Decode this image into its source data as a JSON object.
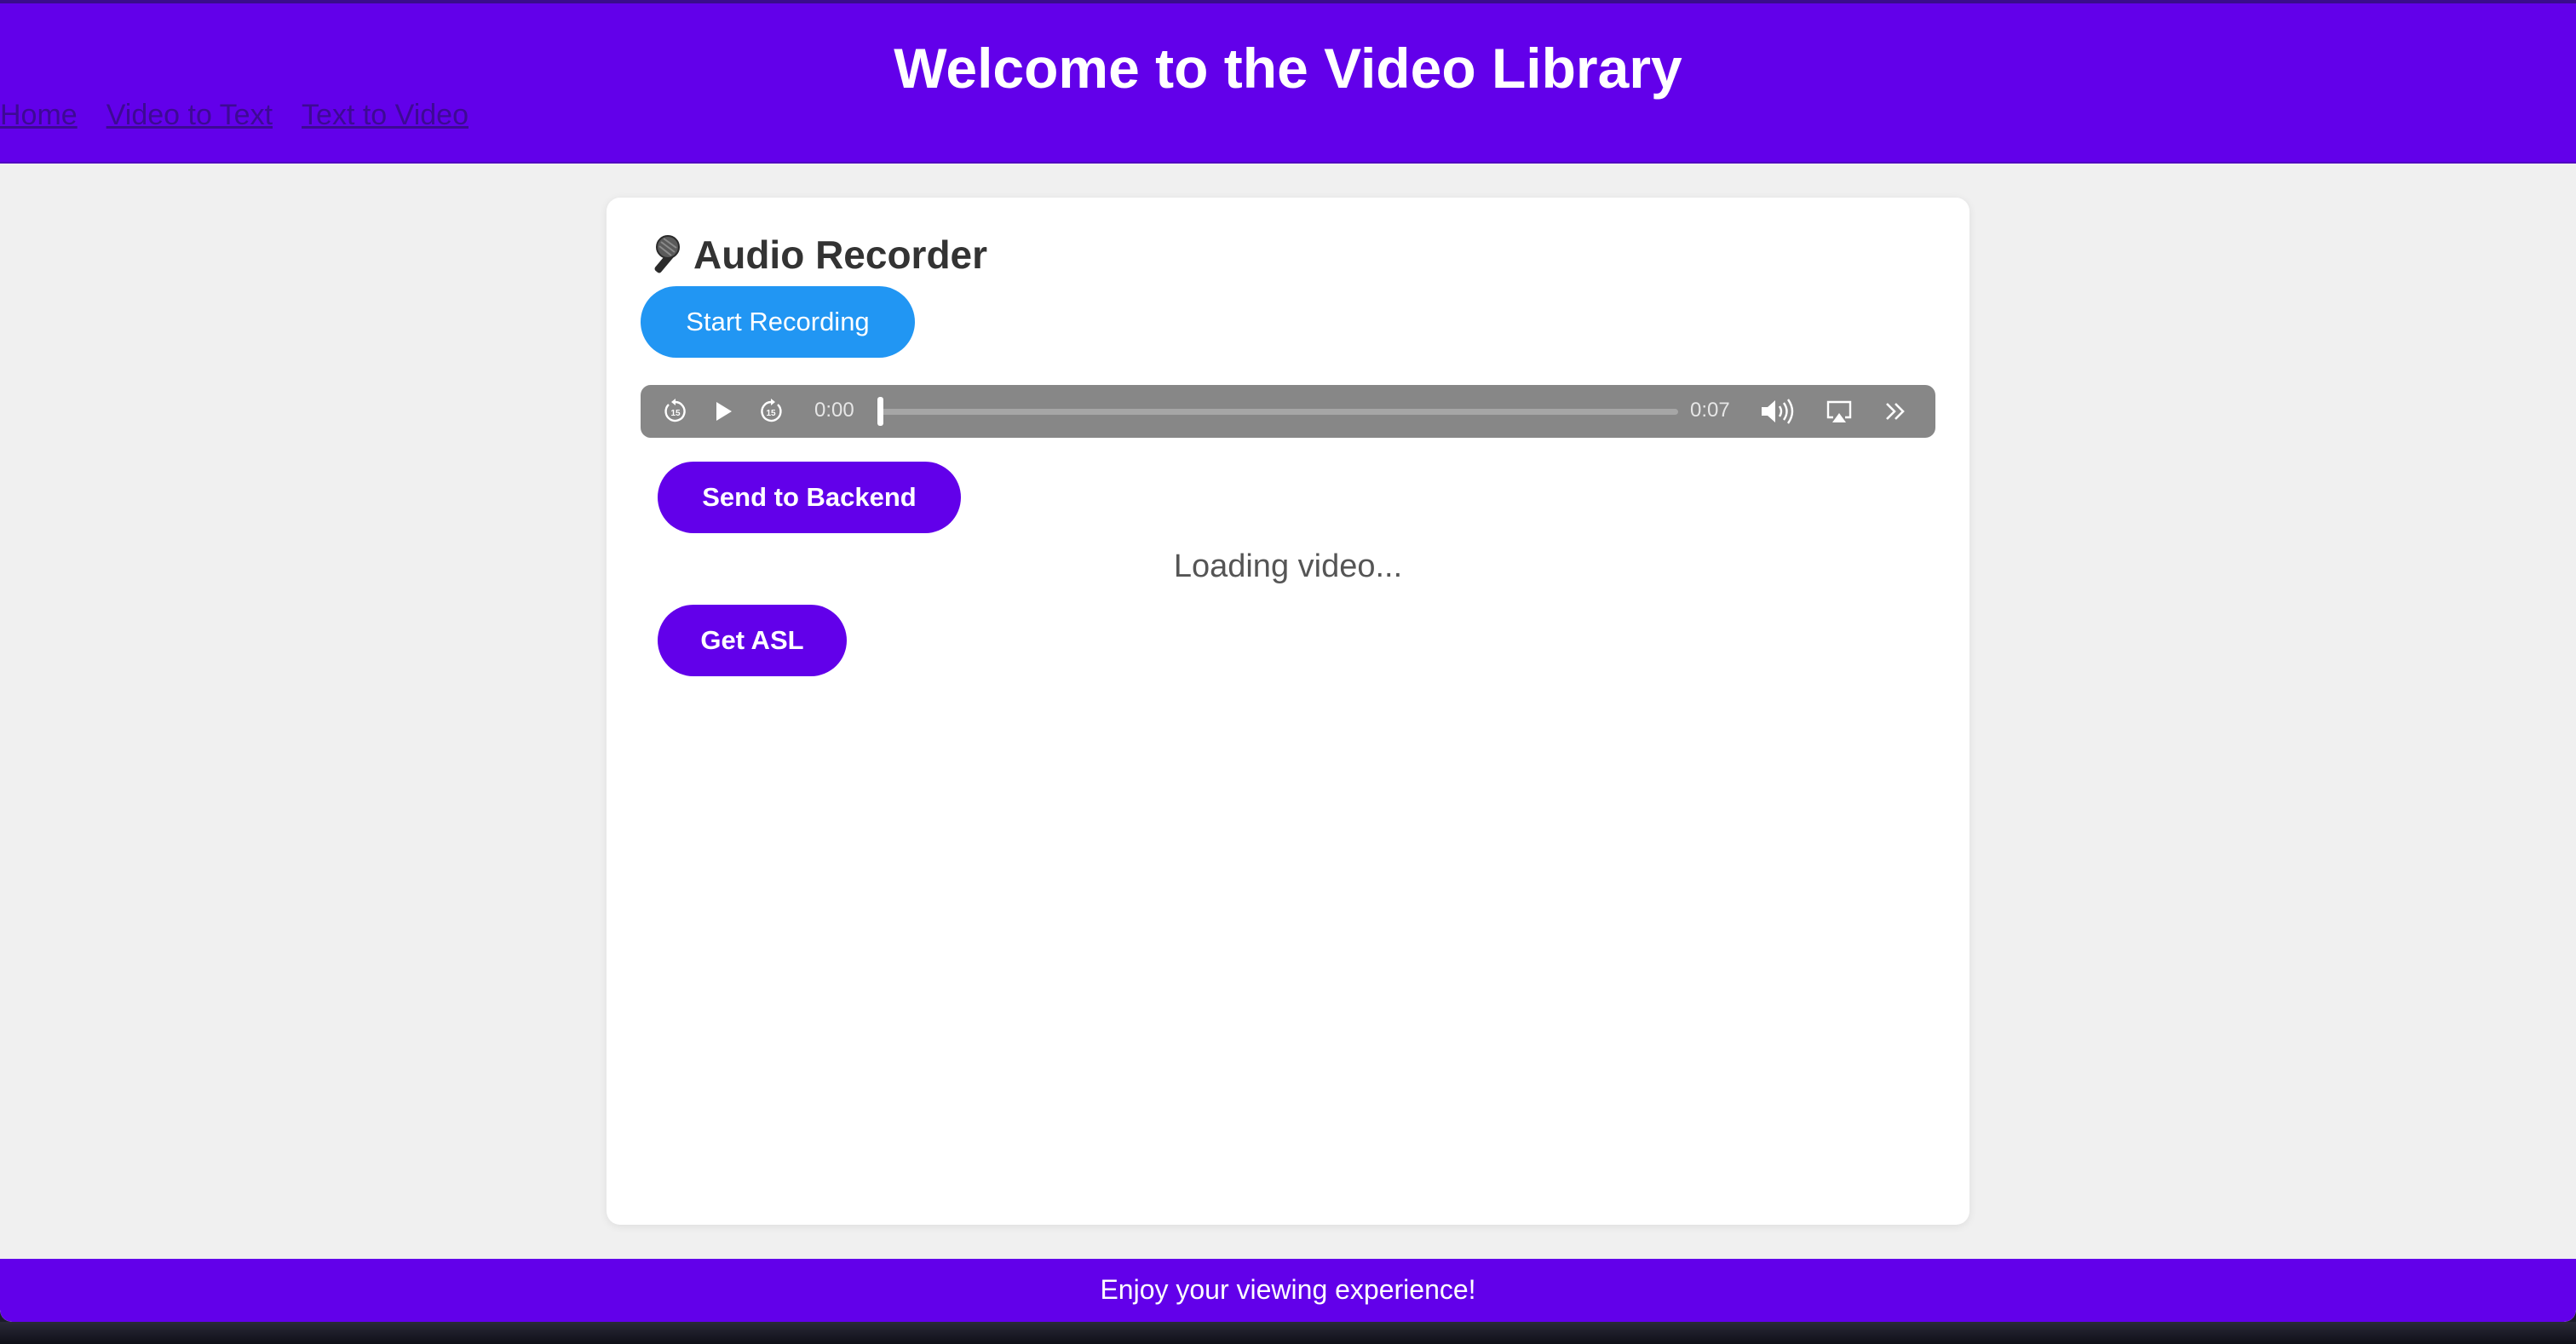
{
  "header": {
    "title": "Welcome to the Video Library",
    "nav": [
      "Home",
      "Video to Text",
      "Text to Video"
    ]
  },
  "recorder": {
    "title": "Audio Recorder",
    "title_icon": "microphone-icon",
    "start_recording_label": "Start Recording",
    "send_label": "Send to Backend",
    "loading_text": "Loading video...",
    "get_asl_label": "Get ASL"
  },
  "player": {
    "current_time": "0:00",
    "duration": "0:07",
    "progress": 0,
    "icons": [
      "skip-back-15-icon",
      "play-icon",
      "skip-forward-15-icon",
      "volume-icon",
      "airplay-icon",
      "more-icon"
    ]
  },
  "footer": {
    "text": "Enjoy your viewing experience!"
  },
  "colors": {
    "header_bg": "#6200ea",
    "footer_bg": "#6200ea",
    "primary_button": "#6200ea",
    "record_button": "#2196f3",
    "page_bg": "#f0f0f0",
    "player_bg": "#878787"
  }
}
